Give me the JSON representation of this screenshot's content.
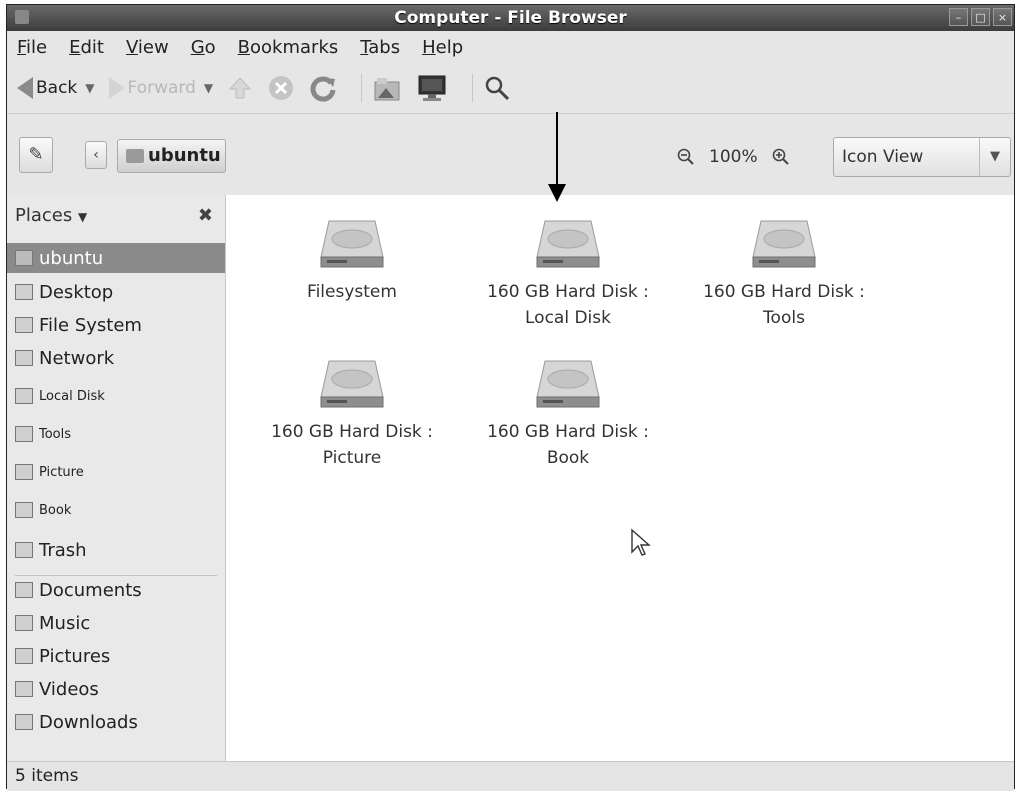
{
  "window": {
    "title": "Computer - File Browser",
    "min": "–",
    "max": "□",
    "close": "×"
  },
  "menu": [
    {
      "mnemonic": "F",
      "rest": "ile"
    },
    {
      "mnemonic": "E",
      "rest": "dit"
    },
    {
      "mnemonic": "V",
      "rest": "iew"
    },
    {
      "mnemonic": "G",
      "rest": "o"
    },
    {
      "mnemonic": "B",
      "rest": "ookmarks"
    },
    {
      "mnemonic": "T",
      "rest": "abs"
    },
    {
      "mnemonic": "H",
      "rest": "elp"
    }
  ],
  "toolbar": {
    "back_label": "Back",
    "forward_label": "Forward"
  },
  "location": {
    "crumb": "ubuntu",
    "zoom": "100%",
    "view": "Icon View"
  },
  "sidebar": {
    "header": "Places",
    "items": [
      {
        "label": "ubuntu",
        "selected": true,
        "small": false,
        "icon": "home-icon"
      },
      {
        "label": "Desktop",
        "small": false,
        "icon": "desktop-icon"
      },
      {
        "label": "File System",
        "small": false,
        "icon": "filesystem-icon"
      },
      {
        "label": "Network",
        "small": false,
        "icon": "network-icon"
      },
      {
        "label": "Local Disk",
        "small": true,
        "icon": "drive-icon"
      },
      {
        "label": "Tools",
        "small": true,
        "icon": "drive-icon"
      },
      {
        "label": "Picture",
        "small": true,
        "icon": "drive-icon"
      },
      {
        "label": "Book",
        "small": true,
        "icon": "drive-icon"
      },
      {
        "label": "Trash",
        "small": false,
        "icon": "trash-icon"
      },
      {
        "label": "Documents",
        "small": false,
        "icon": "folder-documents-icon"
      },
      {
        "label": "Music",
        "small": false,
        "icon": "folder-music-icon"
      },
      {
        "label": "Pictures",
        "small": false,
        "icon": "folder-pictures-icon"
      },
      {
        "label": "Videos",
        "small": false,
        "icon": "folder-videos-icon"
      },
      {
        "label": "Downloads",
        "small": false,
        "icon": "folder-downloads-icon"
      }
    ]
  },
  "content": {
    "items": [
      {
        "line1": "Filesystem",
        "line2": ""
      },
      {
        "line1": "160 GB Hard Disk :",
        "line2": "Local Disk"
      },
      {
        "line1": "160 GB Hard Disk :",
        "line2": "Tools"
      },
      {
        "line1": "160 GB Hard Disk :",
        "line2": "Picture"
      },
      {
        "line1": "160 GB Hard Disk :",
        "line2": "Book"
      }
    ]
  },
  "status": {
    "text": "5 items"
  }
}
